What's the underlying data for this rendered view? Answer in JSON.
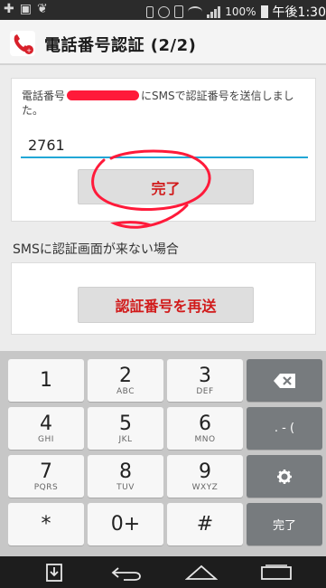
{
  "status_bar": {
    "battery": "100%",
    "time": "午後1:30"
  },
  "header": {
    "title": "電話番号認証 (2/2)"
  },
  "verification": {
    "message_prefix": "電話番号",
    "message_suffix": "にSMSで認証番号を送信しました。",
    "code_value": "2761",
    "done_label": "完了"
  },
  "resend": {
    "label": "SMSに認証画面が来ない場合",
    "button_label": "認証番号を再送"
  },
  "keyboard": {
    "keys": {
      "k1": {
        "main": "1",
        "sub": ""
      },
      "k2": {
        "main": "2",
        "sub": "ABC"
      },
      "k3": {
        "main": "3",
        "sub": "DEF"
      },
      "k4": {
        "main": "4",
        "sub": "GHI"
      },
      "k5": {
        "main": "5",
        "sub": "JKL"
      },
      "k6": {
        "main": "6",
        "sub": "MNO"
      },
      "k7": {
        "main": "7",
        "sub": "PQRS"
      },
      "k8": {
        "main": "8",
        "sub": "TUV"
      },
      "k9": {
        "main": "9",
        "sub": "WXYZ"
      },
      "kstar": {
        "main": "*",
        "sub": ""
      },
      "k0": {
        "main": "0+",
        "sub": ""
      },
      "khash": {
        "main": "#",
        "sub": ""
      }
    },
    "symbols_label": ". - (",
    "done_label": "完了",
    "backspace_icon": "backspace-icon",
    "settings_icon": "gear-icon"
  },
  "navigation": {
    "icons": [
      "download-icon",
      "back-icon",
      "home-icon",
      "recents-icon"
    ]
  },
  "colors": {
    "accent": "#22a7d6",
    "button_text": "#d11a1a",
    "annotation": "#ff1a3a"
  }
}
